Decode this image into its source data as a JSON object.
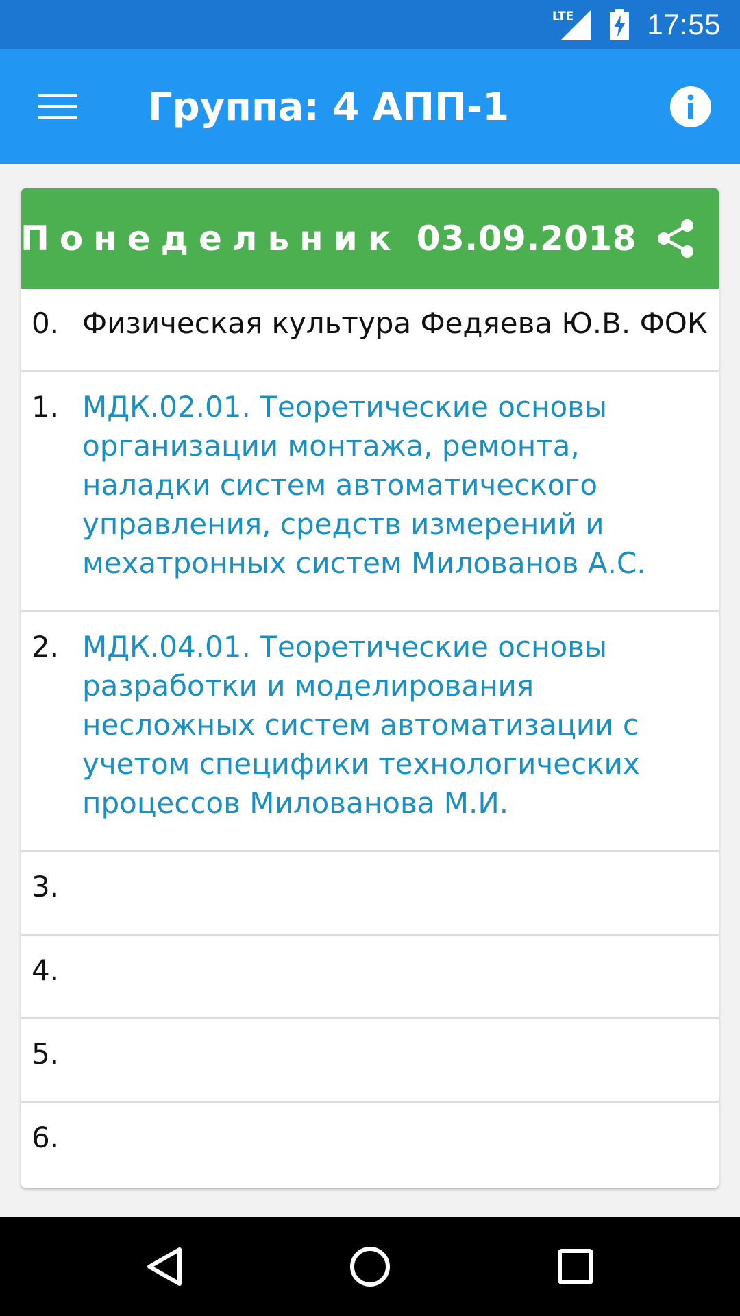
{
  "status_bar": {
    "network": "LTE",
    "time": "17:55"
  },
  "app_bar": {
    "title": "Группа: 4 АПП-1",
    "menu_icon": "hamburger-menu-icon",
    "info_icon": "info-icon"
  },
  "schedule": {
    "day_name": "Понедельник",
    "date": "03.09.2018",
    "share_icon": "share-icon",
    "lessons": [
      {
        "number": "0.",
        "text": "Физическая культура Федяева Ю.В. ФОК"
      },
      {
        "number": "1.",
        "text": "МДК.02.01. Теоретические основы организации монтажа, ремонта, наладки систем автоматического управления, средств измерений и мехатронных систем Милованов А.С."
      },
      {
        "number": "2.",
        "text": "МДК.04.01. Теоретические основы разработки и моделирования несложных систем автоматизации с учетом специфики технологических процессов Милованова М.И."
      },
      {
        "number": "3.",
        "text": ""
      },
      {
        "number": "4.",
        "text": ""
      },
      {
        "number": "5.",
        "text": ""
      },
      {
        "number": "6.",
        "text": ""
      }
    ]
  },
  "colors": {
    "status_bar": "#1c77d2",
    "app_bar": "#2196f3",
    "card_header": "#4caf50",
    "link_text": "#1a8fc4"
  },
  "nav_bar": {
    "back_icon": "back-triangle-icon",
    "home_icon": "home-circle-icon",
    "recents_icon": "recents-square-icon"
  }
}
